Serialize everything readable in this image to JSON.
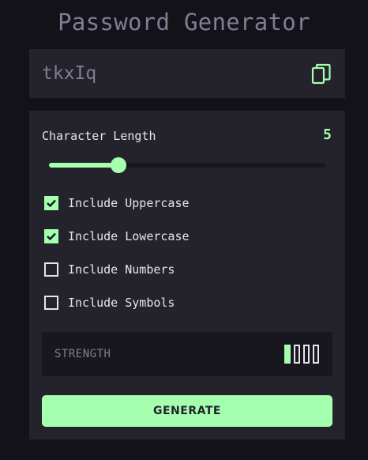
{
  "app": {
    "title": "Password Generator"
  },
  "output": {
    "password": "tkxIq",
    "copy_icon": "copy-icon"
  },
  "length": {
    "label": "Character Length",
    "value": "5",
    "slider_fraction": 0.25
  },
  "options": [
    {
      "label": "Include Uppercase",
      "checked": true
    },
    {
      "label": "Include Lowercase",
      "checked": true
    },
    {
      "label": "Include Numbers",
      "checked": false
    },
    {
      "label": "Include Symbols",
      "checked": false
    }
  ],
  "strength": {
    "label": "STRENGTH",
    "level": 1,
    "max_level": 4
  },
  "generate": {
    "label": "GENERATE"
  },
  "colors": {
    "accent": "#a4ffaf",
    "panel": "#24232c",
    "background": "#131219",
    "muted_text": "#817d92",
    "text": "#e6e5ea"
  }
}
